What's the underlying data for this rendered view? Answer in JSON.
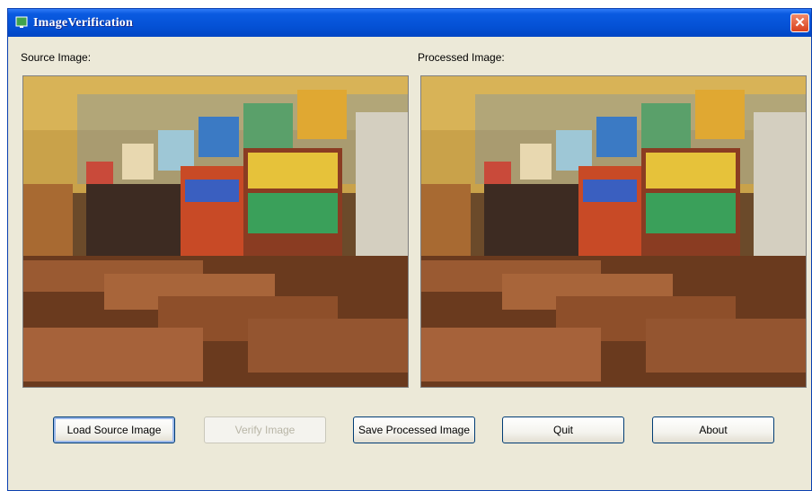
{
  "window": {
    "title": "ImageVerification",
    "close_glyph": "✕"
  },
  "labels": {
    "source": "Source Image:",
    "processed": "Processed Image:"
  },
  "buttons": {
    "load": "Load Source Image",
    "verify": "Verify Image",
    "save": "Save Processed Image",
    "quit": "Quit",
    "about": "About"
  },
  "states": {
    "verify_enabled": false,
    "load_focused": true
  },
  "icons": {
    "app": "app-icon",
    "close": "close-icon"
  },
  "colors": {
    "titlebar": "#0552d6",
    "window_bg": "#ece9d8",
    "close": "#d9411d"
  }
}
